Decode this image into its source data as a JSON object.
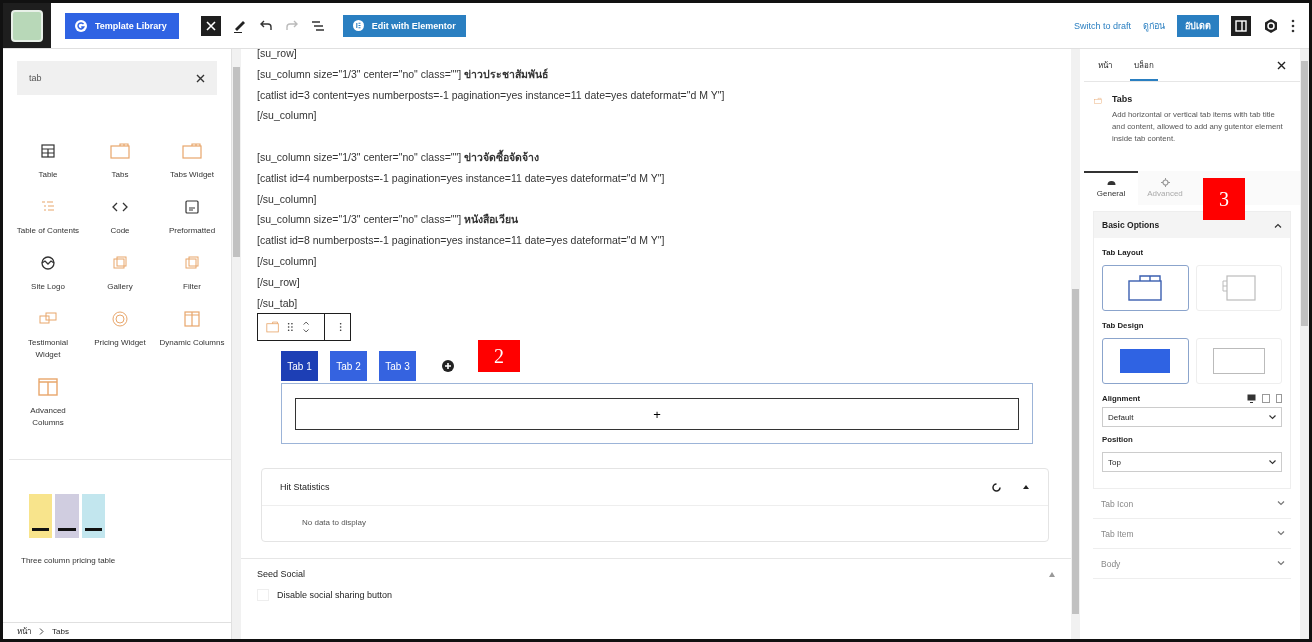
{
  "toolbar": {
    "template_library": "Template Library",
    "edit_elementor": "Edit with Elementor",
    "switch_draft": "Switch to draft",
    "preview": "ดูก่อน",
    "update": "อัปเดต"
  },
  "inserter": {
    "search": {
      "value": "tab"
    },
    "blocks": [
      {
        "label": "Table",
        "kind": "table"
      },
      {
        "label": "Tabs",
        "kind": "tabs"
      },
      {
        "label": "Tabs Widget",
        "kind": "tabs"
      },
      {
        "label": "Table of Contents",
        "kind": "toc"
      },
      {
        "label": "Code",
        "kind": "code"
      },
      {
        "label": "Preformatted",
        "kind": "pre"
      },
      {
        "label": "Site Logo",
        "kind": "logo"
      },
      {
        "label": "Gallery",
        "kind": "gallery"
      },
      {
        "label": "Filter",
        "kind": "gallery"
      },
      {
        "label": "Testimonial Widget",
        "kind": "testimonial"
      },
      {
        "label": "Pricing Widget",
        "kind": "pricing"
      },
      {
        "label": "Dynamic Columns",
        "kind": "columns"
      },
      {
        "label": "Advanced Columns",
        "kind": "advcolumns"
      }
    ],
    "pattern": {
      "label": "Three column pricing table"
    },
    "breadcrumb": [
      "หน้า",
      "Tabs"
    ]
  },
  "editor": {
    "code_lines": [
      "[su_row]",
      "[su_column size=\"1/3\" center=\"no\" class=\"\"] **ข่าวประชาสัมพันธ์**",
      "[catlist id=3 content=yes numberposts=-1 pagination=yes instance=11 date=yes dateformat=\"d M Y\"]",
      "[/su_column]",
      "[su_column size=\"1/3\" center=\"no\" class=\"\"] **ข่าวจัดซื้อจัดจ้าง**",
      "[catlist id=4 numberposts=-1 pagination=yes instance=11 date=yes dateformat=\"d M Y\"]",
      "[/su_column]",
      "[su_column size=\"1/3\" center=\"no\" class=\"\"] **หนังสือเวียน**",
      "[catlist id=8 numberposts=-1 pagination=yes instance=11 date=yes dateformat=\"d M Y\"]",
      "[/su_column]",
      "[/su_row]",
      "[/su_tab]"
    ],
    "tabs": [
      {
        "label": "Tab 1",
        "selected": true
      },
      {
        "label": "Tab 2",
        "selected": false
      },
      {
        "label": "Tab 3",
        "selected": false
      }
    ],
    "add_block": "+",
    "hit_statistics": {
      "title": "Hit Statistics",
      "empty": "No data to display"
    },
    "seed_social": {
      "title": "Seed Social",
      "checkbox": {
        "label": "Disable social sharing button",
        "checked": false
      }
    }
  },
  "sidebar": {
    "tabs": [
      {
        "label": "หน้า",
        "selected": false
      },
      {
        "label": "บล็อก",
        "selected": true
      }
    ],
    "block": {
      "title": "Tabs",
      "description": "Add horizontal or vertical tab items with tab title and content, allowed to add any gutentor element inside tab content."
    },
    "panel_tabs": [
      {
        "label": "General",
        "kind": "general",
        "selected": true
      },
      {
        "label": "Advanced",
        "kind": "advanced",
        "selected": false
      }
    ],
    "basic_options": {
      "title": "Basic Options",
      "expanded": true,
      "tab_layout": {
        "label": "Tab Layout",
        "options": [
          {
            "kind": "horizontal",
            "selected": true
          },
          {
            "kind": "vertical",
            "selected": false
          }
        ]
      },
      "tab_design": {
        "label": "Tab Design",
        "options": [
          {
            "kind": "filled",
            "selected": true
          },
          {
            "kind": "outline",
            "selected": false
          }
        ]
      },
      "alignment": {
        "label": "Alignment",
        "value": "Default"
      },
      "position": {
        "label": "Position",
        "value": "Top"
      }
    },
    "sections": [
      "Tab Icon",
      "Tab Item",
      "Body"
    ]
  },
  "callouts": [
    {
      "label": "2",
      "kind": "editor"
    },
    {
      "label": "3",
      "kind": "sidebar"
    }
  ]
}
